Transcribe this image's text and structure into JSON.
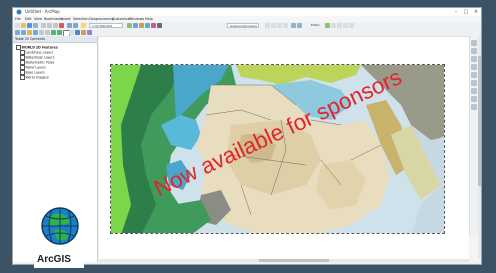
{
  "window": {
    "title": "Untitled - ArcMap"
  },
  "menu": [
    "File",
    "Edit",
    "View",
    "Bookmarks",
    "Insert",
    "Selection",
    "Geoprocessing",
    "Customize",
    "Windows",
    "Help"
  ],
  "toolbar": {
    "scale_value": "1:30,000,000",
    "layer_value": "Arabian Peninsula",
    "editor_label": "Editor"
  },
  "toc": {
    "title": "Table Of Contents",
    "items": [
      "WORLD 2D Features",
      "Landmass Layers",
      "Waterbody Layers",
      "Bathymetric Polys",
      "Relief Layers",
      "Base Layers",
      "World Imagery"
    ]
  },
  "status": {
    "coords": ""
  },
  "watermark": {
    "text": "Now available for sponsors"
  },
  "logo": {
    "text": "ArcGIS"
  }
}
